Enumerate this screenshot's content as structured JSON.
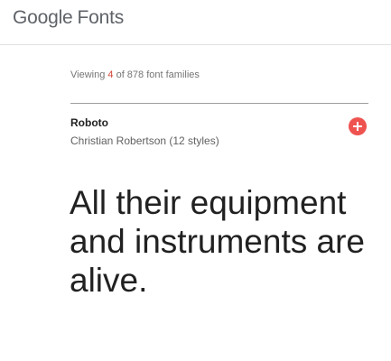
{
  "header": {
    "logo_text": "Google",
    "product_name": "Fonts"
  },
  "catalog": {
    "viewing_prefix": "Viewing ",
    "viewing_count": "4",
    "viewing_suffix": " of 878 font families"
  },
  "font_card": {
    "name": "Roboto",
    "designer_styles": "Christian Robertson (12 styles)",
    "add_icon": "plus-circle-icon",
    "add_color": "#ef5350",
    "sample_text": "All their equipment and instruments are alive."
  }
}
